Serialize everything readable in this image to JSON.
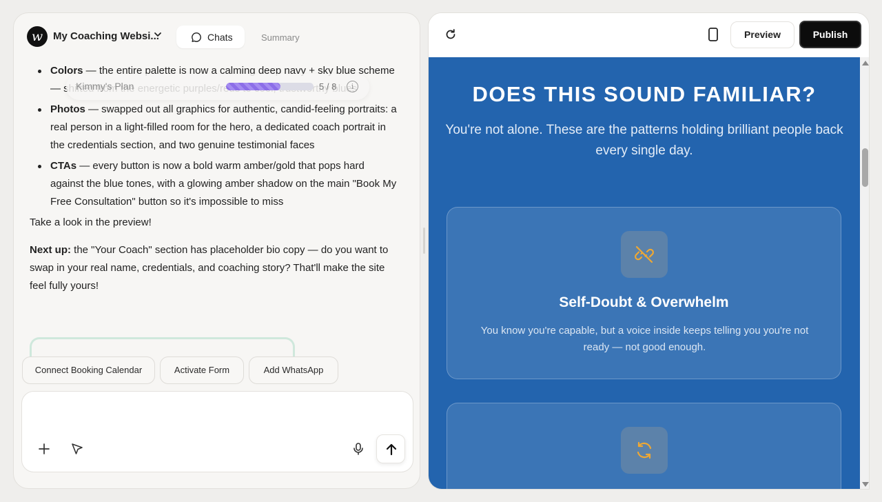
{
  "header": {
    "site_name": "My Coaching Websi...",
    "tabs": {
      "chats": "Chats",
      "summary": "Summary"
    }
  },
  "chat": {
    "bullets": [
      {
        "label": "Colors",
        "text": " — the entire palette is now a calming deep navy + sky blue scheme — shifted from the energetic purples/reds to cool, trustworthy blues"
      },
      {
        "label": "Photos",
        "text": " — swapped out all graphics for authentic, candid-feeling portraits: a real person in a light-filled room for the hero, a dedicated coach portrait in the credentials section, and two genuine testimonial faces"
      },
      {
        "label": "CTAs",
        "text": " — every button is now a bold warm amber/gold that pops hard against the blue tones, with a glowing amber shadow on the main \"Book My Free Consultation\" button so it's impossible to miss"
      }
    ],
    "look": "Take a look in the preview!",
    "next_label": "Next up:",
    "next_text": " the \"Your Coach\" section has placeholder bio copy — do you want to swap in your real name, credentials, and coaching story? That'll make the site feel fully yours!"
  },
  "plan": {
    "name": "Kimmy's Plan",
    "count": "5 / 8",
    "progress": 0.625,
    "info": "i"
  },
  "chips": [
    "Connect Booking Calendar",
    "Activate Form",
    "Add WhatsApp"
  ],
  "composer": {
    "placeholder": ""
  },
  "toolbar": {
    "preview": "Preview",
    "publish": "Publish"
  },
  "site": {
    "heading": "DOES THIS SOUND FAMILIAR?",
    "subheading": "You're not alone. These are the patterns holding brilliant people back every single day.",
    "cards": [
      {
        "title": "Self-Doubt & Overwhelm",
        "desc": "You know you're capable, but a voice inside keeps telling you you're not ready — not good enough.",
        "icon": "broken-link-icon"
      },
      {
        "title": "",
        "desc": "",
        "icon": "cycle-icon"
      }
    ]
  },
  "colors": {
    "site_bg": "#2364ae",
    "accent_amber": "#f0a832",
    "plan_purple": "#8c6ee8"
  }
}
